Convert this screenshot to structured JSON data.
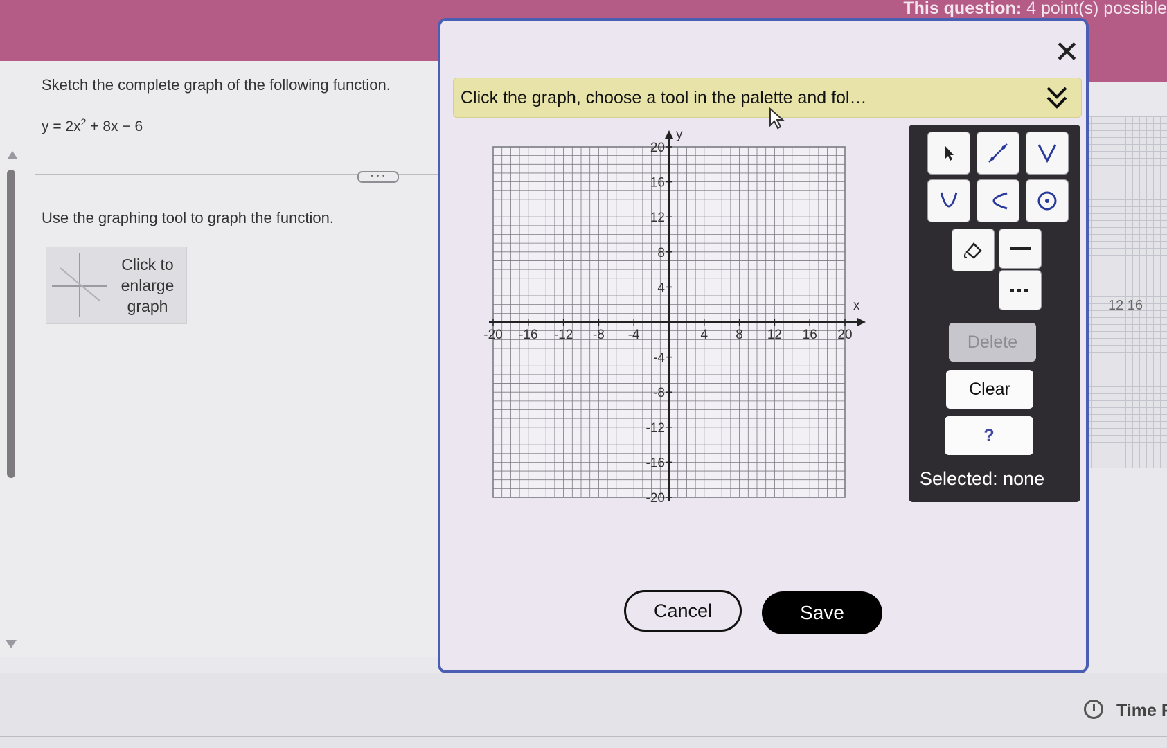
{
  "header": {
    "question_label": "This question:",
    "points_text": "4 point(s) possible"
  },
  "question": {
    "prompt": "Sketch the complete graph of the following function.",
    "equation_lhs": "y = 2x",
    "equation_exp": "2",
    "equation_rest": " + 8x − 6",
    "instruction": "Use the graphing tool to graph the function.",
    "enlarge_label": "Click to enlarge graph",
    "more_label": "• • •"
  },
  "dialog": {
    "close_icon": "close-icon",
    "hint": "Click the graph, choose a tool in the palette and fol…",
    "graph": {
      "x_label": "x",
      "y_label": "y",
      "x_range": [
        -20,
        20
      ],
      "y_range": [
        -20,
        20
      ],
      "x_ticks": [
        "-20",
        "-16",
        "-12",
        "-8",
        "-4",
        "4",
        "8",
        "12",
        "16",
        "20"
      ],
      "y_ticks": [
        "20",
        "16",
        "12",
        "8",
        "4",
        "-4",
        "-8",
        "-12",
        "-16",
        "-20"
      ],
      "grid": true
    },
    "palette": {
      "tools": [
        "pointer-tool",
        "line-tool",
        "v-shape-tool",
        "parabola-up-tool",
        "parabola-left-tool",
        "circle-tool",
        "fill-tool",
        "solid-line-tool",
        "dashed-line-tool"
      ],
      "delete_label": "Delete",
      "clear_label": "Clear",
      "help_label": "?",
      "selected_text": "Selected: none"
    },
    "cancel_label": "Cancel",
    "save_label": "Save"
  },
  "side": {
    "labels": "12    16"
  },
  "footer": {
    "time_label": "Time R"
  }
}
